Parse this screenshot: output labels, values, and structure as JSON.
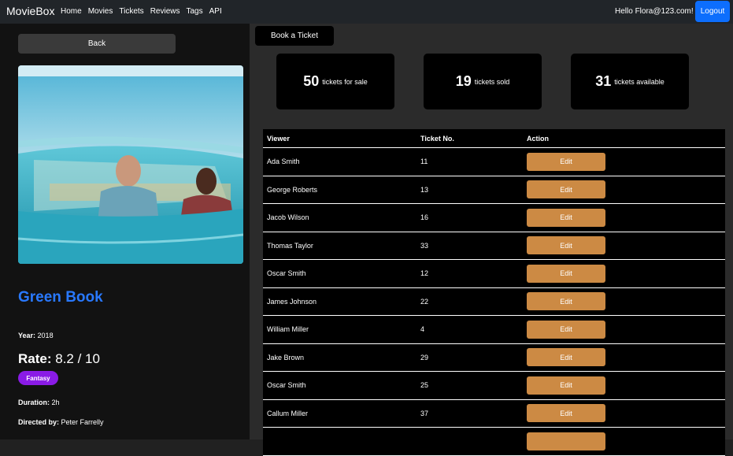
{
  "nav": {
    "brand": "MovieBox",
    "links": [
      "Home",
      "Movies",
      "Tickets",
      "Reviews",
      "Tags",
      "API"
    ],
    "greeting": "Hello Flora@123.com!",
    "logout": "Logout"
  },
  "sidebar": {
    "back": "Back",
    "title": "Green Book",
    "year_label": "Year:",
    "year": "2018",
    "rate_label": "Rate:",
    "rate": "8.2 / 10",
    "genre": "Fantasy",
    "duration_label": "Duration:",
    "duration": "2h",
    "director_label": "Directed by:",
    "director": "Peter Farrelly"
  },
  "main": {
    "book": "Book a Ticket",
    "stats": [
      {
        "num": "50",
        "label": "tickets for sale"
      },
      {
        "num": "19",
        "label": "tickets sold"
      },
      {
        "num": "31",
        "label": "tickets available"
      }
    ],
    "columns": [
      "Viewer",
      "Ticket No.",
      "Action"
    ],
    "rows": [
      {
        "viewer": "Ada Smith",
        "ticket": "11",
        "action": "Edit"
      },
      {
        "viewer": "George Roberts",
        "ticket": "13",
        "action": "Edit"
      },
      {
        "viewer": "Jacob Wilson",
        "ticket": "16",
        "action": "Edit"
      },
      {
        "viewer": "Thomas Taylor",
        "ticket": "33",
        "action": "Edit"
      },
      {
        "viewer": "Oscar Smith",
        "ticket": "12",
        "action": "Edit"
      },
      {
        "viewer": "James Johnson",
        "ticket": "22",
        "action": "Edit"
      },
      {
        "viewer": "William Miller",
        "ticket": "4",
        "action": "Edit"
      },
      {
        "viewer": "Jake Brown",
        "ticket": "29",
        "action": "Edit"
      },
      {
        "viewer": "Oscar Smith",
        "ticket": "25",
        "action": "Edit"
      },
      {
        "viewer": "Callum Miller",
        "ticket": "37",
        "action": "Edit"
      }
    ]
  },
  "colors": {
    "accent": "#0d6efd",
    "title": "#2979ff",
    "genre": "#8a1be6",
    "edit": "#cc8a44"
  }
}
